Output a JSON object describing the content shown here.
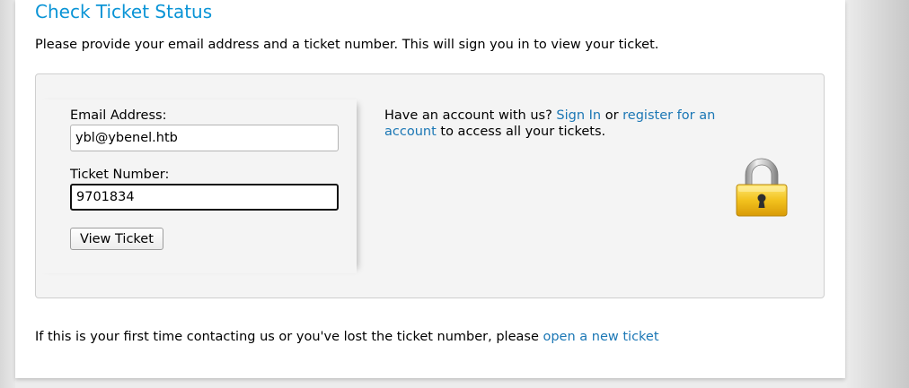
{
  "header": {
    "title": "Check Ticket Status"
  },
  "intro": {
    "text": "Please provide your email address and a ticket number. This will sign you in to view your ticket."
  },
  "form": {
    "email_label": "Email Address:",
    "email_value": "ybl@ybenel.htb",
    "ticket_label": "Ticket Number:",
    "ticket_value": "9701834",
    "submit_label": "View Ticket"
  },
  "account": {
    "prefix": "Have an account with us?",
    "sign_in_link": "Sign In",
    "or_text": "or",
    "register_link": "register for an account",
    "suffix": "to access all your tickets."
  },
  "lock_icon": "padlock-icon",
  "footer": {
    "text": "If this is your first time contacting us or you've lost the ticket number, please",
    "link": "open a new ticket"
  },
  "colors": {
    "title": "#0a94d6",
    "link": "#1b77b5",
    "panel_bg": "#f4f4f4",
    "lock_gold": "#f2c21e"
  }
}
